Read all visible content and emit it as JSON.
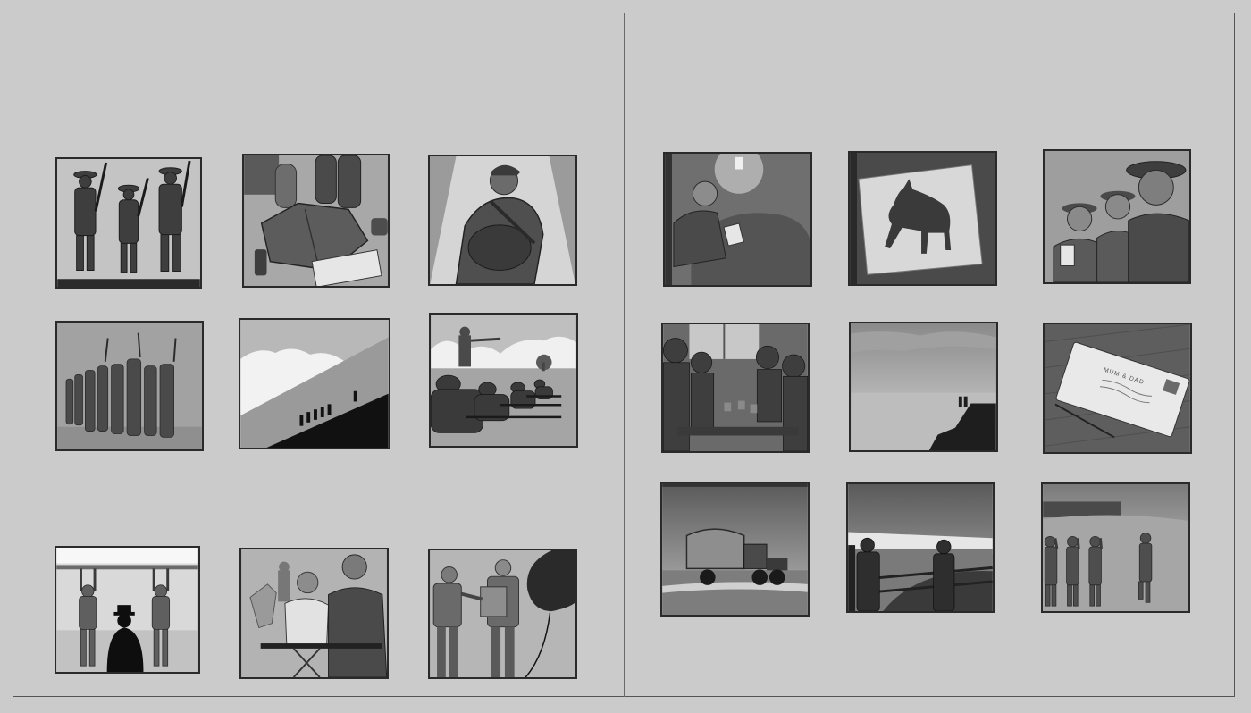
{
  "page": {
    "background_color": "#cbcbcb",
    "border_color": "#555555"
  },
  "left_page": {
    "panels": [
      {
        "id": 1,
        "icon": "soldiers-standing-illustration"
      },
      {
        "id": 2,
        "icon": "uniform-kit-illustration"
      },
      {
        "id": 3,
        "icon": "soldier-seated-illustration"
      },
      {
        "id": 4,
        "icon": "marching-column-illustration"
      },
      {
        "id": 5,
        "icon": "hill-silhouette-illustration"
      },
      {
        "id": 6,
        "icon": "rifle-drill-illustration"
      },
      {
        "id": 7,
        "icon": "pullup-bar-illustration"
      },
      {
        "id": 8,
        "icon": "sergeant-and-recruit-illustration"
      },
      {
        "id": 9,
        "icon": "horse-handover-illustration"
      }
    ]
  },
  "right_page": {
    "panels": [
      {
        "id": 10,
        "icon": "soldier-reading-letter-illustration"
      },
      {
        "id": 11,
        "icon": "horse-drawing-illustration"
      },
      {
        "id": 12,
        "icon": "soldiers-with-photo-illustration"
      },
      {
        "id": 13,
        "icon": "mess-hall-illustration"
      },
      {
        "id": 14,
        "icon": "cliff-lookout-illustration"
      },
      {
        "id": 15,
        "icon": "postcard-illustration",
        "postcard_text": "MUM & DAD"
      },
      {
        "id": 16,
        "icon": "army-truck-illustration"
      },
      {
        "id": 17,
        "icon": "cliffs-ship-deck-illustration"
      },
      {
        "id": 18,
        "icon": "saluting-soldiers-illustration"
      }
    ]
  }
}
